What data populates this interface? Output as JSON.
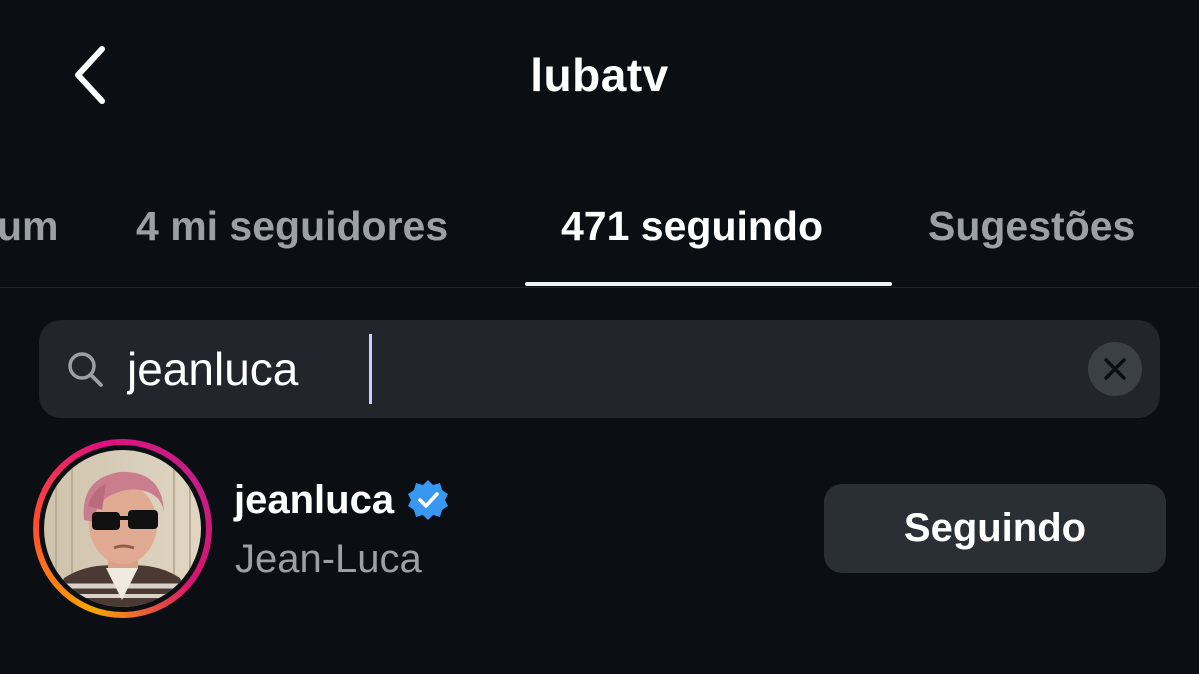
{
  "header": {
    "title": "lubatv",
    "back_icon": "chevron-left-icon"
  },
  "tabs": [
    {
      "label": "um",
      "active": false
    },
    {
      "label": "4 mi seguidores",
      "active": false
    },
    {
      "label": "471 seguindo",
      "active": true
    },
    {
      "label": "Sugestões",
      "active": false
    }
  ],
  "search": {
    "value": "jeanluca",
    "icon": "search-icon",
    "clear_icon": "close-icon"
  },
  "results": [
    {
      "username": "jeanluca",
      "full_name": "Jean-Luca",
      "verified": true,
      "button_label": "Seguindo",
      "has_story_ring": true
    }
  ],
  "colors": {
    "background": "#0b0f14",
    "text_primary": "#ffffff",
    "text_secondary": "#9aa0a6",
    "search_bg": "#22262c",
    "button_bg": "#2a2e35",
    "verified_blue": "#3897f0"
  }
}
